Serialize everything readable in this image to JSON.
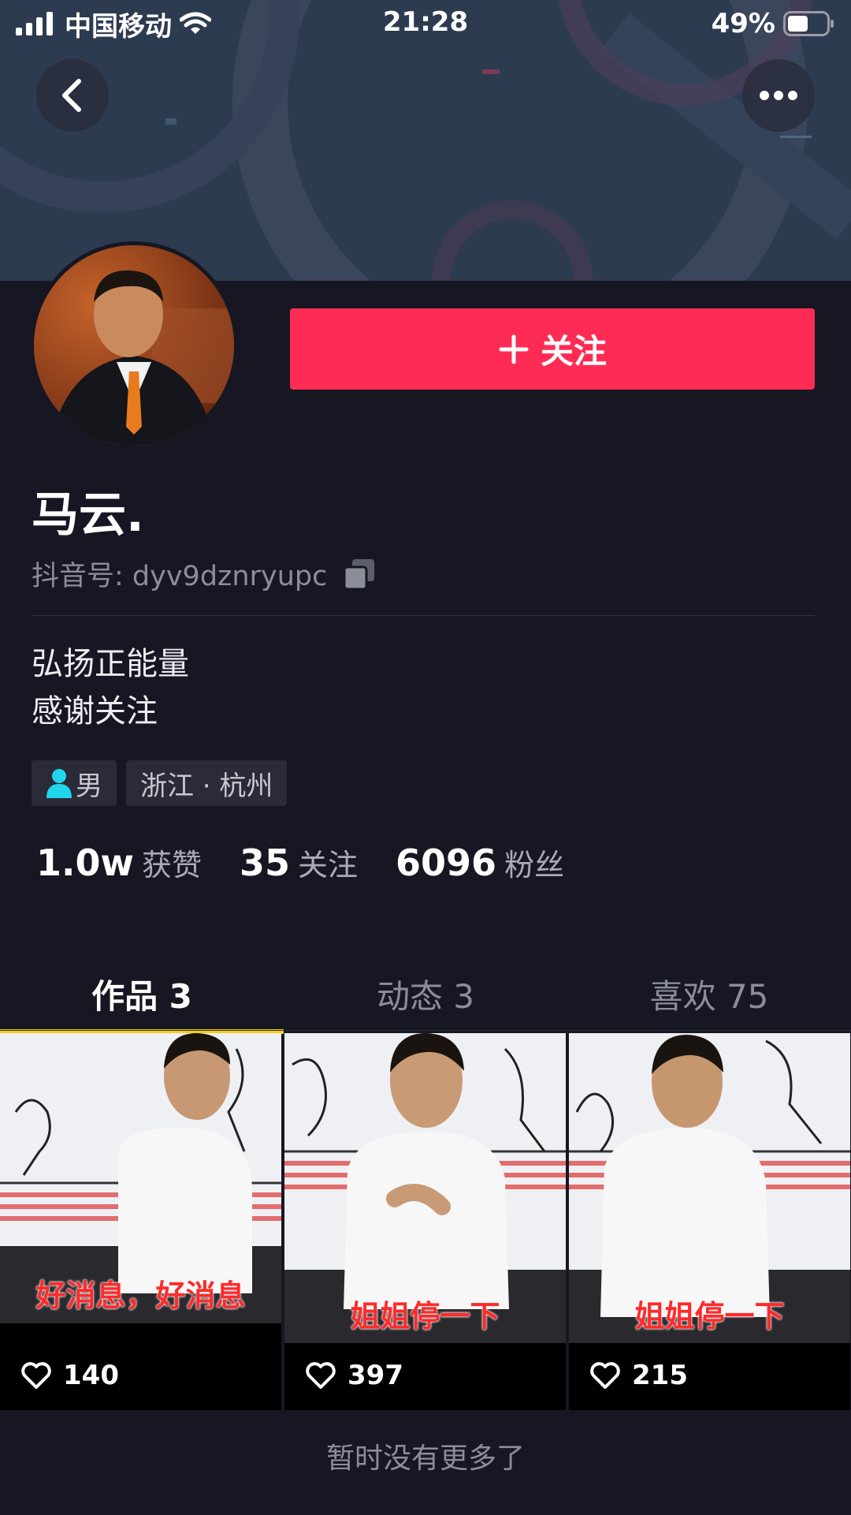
{
  "status_bar": {
    "carrier": "中国移动",
    "time": "21:28",
    "battery": "49%"
  },
  "profile": {
    "follow_label": "关注",
    "username": "马云.",
    "douyin_id": "抖音号: dyv9dznryupc",
    "bio_lines": [
      "弘扬正能量",
      "感谢关注"
    ],
    "tags": {
      "gender": "男",
      "location": "浙江 · 杭州"
    },
    "stats": [
      {
        "value": "1.0w",
        "label": "获赞"
      },
      {
        "value": "35",
        "label": "关注"
      },
      {
        "value": "6096",
        "label": "粉丝"
      }
    ]
  },
  "tabs": [
    {
      "label": "作品 3",
      "active": true
    },
    {
      "label": "动态 3",
      "active": false
    },
    {
      "label": "喜欢 75",
      "active": false
    }
  ],
  "videos": [
    {
      "caption": "好消息，好消息",
      "likes": "140"
    },
    {
      "caption": "姐姐停一下",
      "likes": "397"
    },
    {
      "caption": "姐姐停一下",
      "likes": "215"
    }
  ],
  "footer_note": "暂时没有更多了",
  "colors": {
    "background": "#161722",
    "accent": "#fe2c55",
    "tab_indicator": "#face15",
    "gender_icon": "#20d5ec"
  }
}
